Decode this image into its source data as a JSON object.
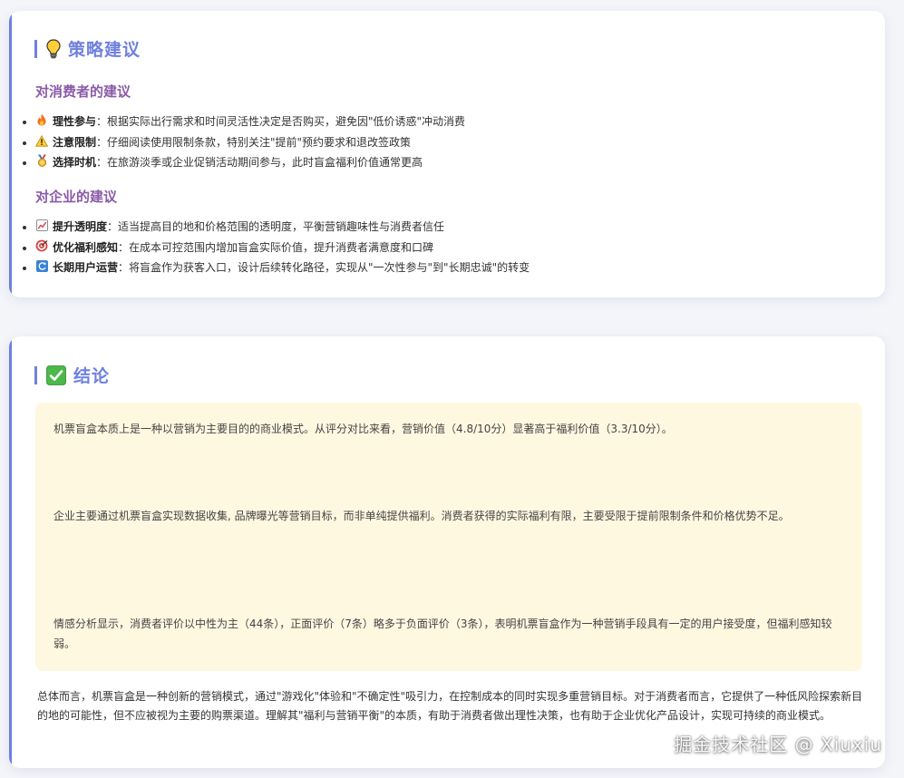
{
  "strategy": {
    "title": "策略建议",
    "title_icon": "lightbulb-icon",
    "consumer": {
      "title": "对消费者的建议",
      "items": [
        {
          "icon": "fire-icon",
          "label": "理性参与",
          "text": "：根据实际出行需求和时间灵活性决定是否购买，避免因\"低价诱惑\"冲动消费"
        },
        {
          "icon": "warning-icon",
          "label": "注意限制",
          "text": "：仔细阅读使用限制条款，特别关注\"提前\"预约要求和退改签政策"
        },
        {
          "icon": "medal-icon",
          "label": "选择时机",
          "text": "：在旅游淡季或企业促销活动期间参与，此时盲盒福利价值通常更高"
        }
      ]
    },
    "enterprise": {
      "title": "对企业的建议",
      "items": [
        {
          "icon": "chart-icon",
          "label": "提升透明度",
          "text": "：适当提高目的地和价格范围的透明度，平衡营销趣味性与消费者信任"
        },
        {
          "icon": "target-icon",
          "label": "优化福利感知",
          "text": "：在成本可控范围内增加盲盒实际价值，提升消费者满意度和口碑"
        },
        {
          "icon": "refresh-icon",
          "label": "长期用户运营",
          "text": "：将盲盒作为获客入口，设计后续转化路径，实现从\"一次性参与\"到\"长期忠诚\"的转变"
        }
      ]
    }
  },
  "conclusion": {
    "title": "结论",
    "title_icon": "check-icon",
    "paragraphs": [
      "机票盲盒本质上是一种以营销为主要目的的商业模式。从评分对比来看，营销价值（4.8/10分）显著高于福利价值（3.3/10分）。",
      "企业主要通过机票盲盒实现数据收集, 品牌曝光等营销目标，而非单纯提供福利。消费者获得的实际福利有限，主要受限于提前限制条件和价格优势不足。",
      "情感分析显示，消费者评价以中性为主（44条），正面评价（7条）略多于负面评价（3条），表明机票盲盒作为一种营销手段具有一定的用户接受度，但福利感知较弱。"
    ],
    "summary": "总体而言，机票盲盒是一种创新的营销模式，通过\"游戏化\"体验和\"不确定性\"吸引力，在控制成本的同时实现多重营销目标。对于消费者而言，它提供了一种低风险探索新目的地的可能性，但不应被视为主要的购票渠道。理解其\"福利与营销平衡\"的本质，有助于消费者做出理性决策，也有助于企业优化产品设计，实现可持续的商业模式。"
  },
  "watermark": "掘金技术社区 @ Xiuxiu",
  "colors": {
    "accent": "#6f80df",
    "subtitle": "#8a5aa8",
    "highlight_bg": "#fff8e1"
  }
}
